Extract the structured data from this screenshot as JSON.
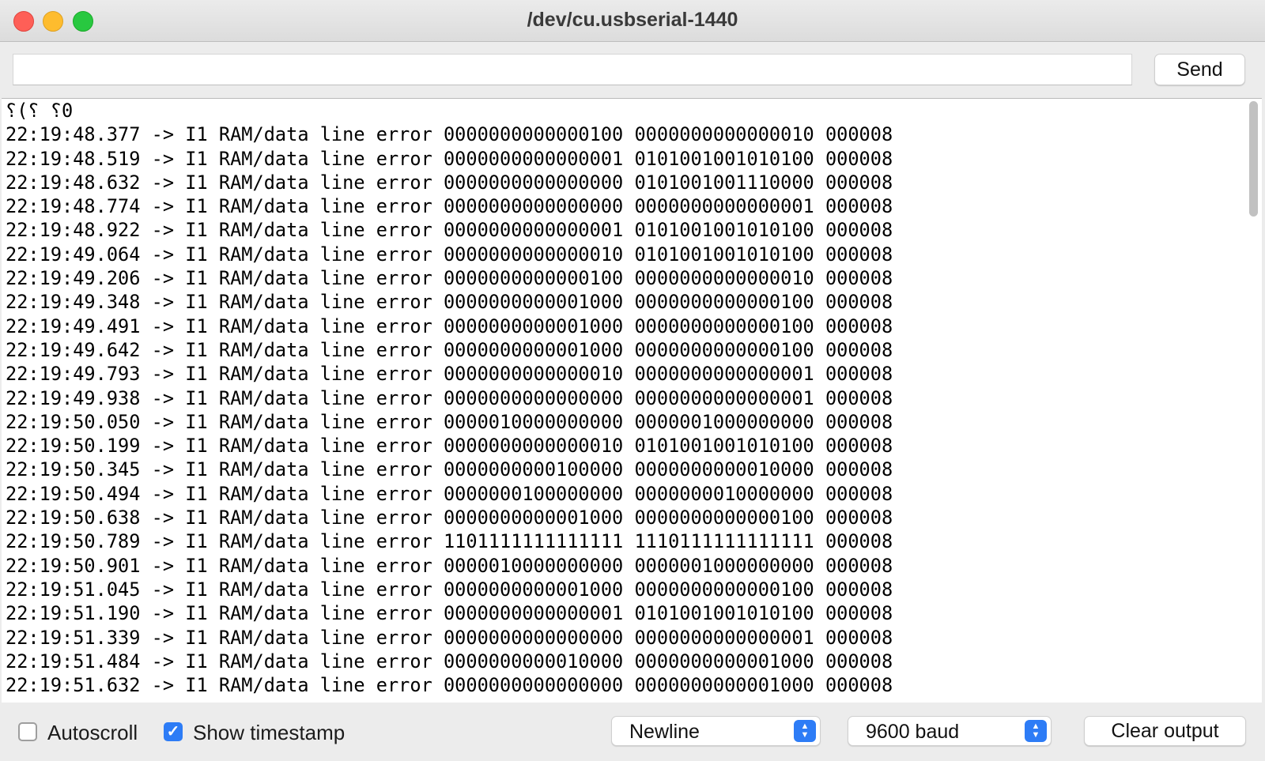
{
  "window": {
    "title": "/dev/cu.usbserial-1440"
  },
  "send_bar": {
    "input_value": "",
    "send_label": "Send"
  },
  "output": {
    "lines": [
      "⸮(⸮ ⸮0",
      "22:19:48.377 -> I1 RAM/data line error 0000000000000100 0000000000000010 000008",
      "22:19:48.519 -> I1 RAM/data line error 0000000000000001 0101001001010100 000008",
      "22:19:48.632 -> I1 RAM/data line error 0000000000000000 0101001001110000 000008",
      "22:19:48.774 -> I1 RAM/data line error 0000000000000000 0000000000000001 000008",
      "22:19:48.922 -> I1 RAM/data line error 0000000000000001 0101001001010100 000008",
      "22:19:49.064 -> I1 RAM/data line error 0000000000000010 0101001001010100 000008",
      "22:19:49.206 -> I1 RAM/data line error 0000000000000100 0000000000000010 000008",
      "22:19:49.348 -> I1 RAM/data line error 0000000000001000 0000000000000100 000008",
      "22:19:49.491 -> I1 RAM/data line error 0000000000001000 0000000000000100 000008",
      "22:19:49.642 -> I1 RAM/data line error 0000000000001000 0000000000000100 000008",
      "22:19:49.793 -> I1 RAM/data line error 0000000000000010 0000000000000001 000008",
      "22:19:49.938 -> I1 RAM/data line error 0000000000000000 0000000000000001 000008",
      "22:19:50.050 -> I1 RAM/data line error 0000010000000000 0000001000000000 000008",
      "22:19:50.199 -> I1 RAM/data line error 0000000000000010 0101001001010100 000008",
      "22:19:50.345 -> I1 RAM/data line error 0000000000100000 0000000000010000 000008",
      "22:19:50.494 -> I1 RAM/data line error 0000000100000000 0000000010000000 000008",
      "22:19:50.638 -> I1 RAM/data line error 0000000000001000 0000000000000100 000008",
      "22:19:50.789 -> I1 RAM/data line error 1101111111111111 1110111111111111 000008",
      "22:19:50.901 -> I1 RAM/data line error 0000010000000000 0000001000000000 000008",
      "22:19:51.045 -> I1 RAM/data line error 0000000000001000 0000000000000100 000008",
      "22:19:51.190 -> I1 RAM/data line error 0000000000000001 0101001001010100 000008",
      "22:19:51.339 -> I1 RAM/data line error 0000000000000000 0000000000000001 000008",
      "22:19:51.484 -> I1 RAM/data line error 0000000000010000 0000000000001000 000008",
      "22:19:51.632 -> I1 RAM/data line error 0000000000000000 0000000000001000 000008"
    ]
  },
  "bottom_bar": {
    "autoscroll_label": "Autoscroll",
    "autoscroll_checked": false,
    "show_timestamp_label": "Show timestamp",
    "show_timestamp_checked": true,
    "line_ending_value": "Newline",
    "baud_value": "9600 baud",
    "clear_output_label": "Clear output"
  },
  "colors": {
    "accent": "#2d7cf6",
    "close": "#fe5f57",
    "minimize": "#febc2e",
    "maximize": "#28c840"
  }
}
